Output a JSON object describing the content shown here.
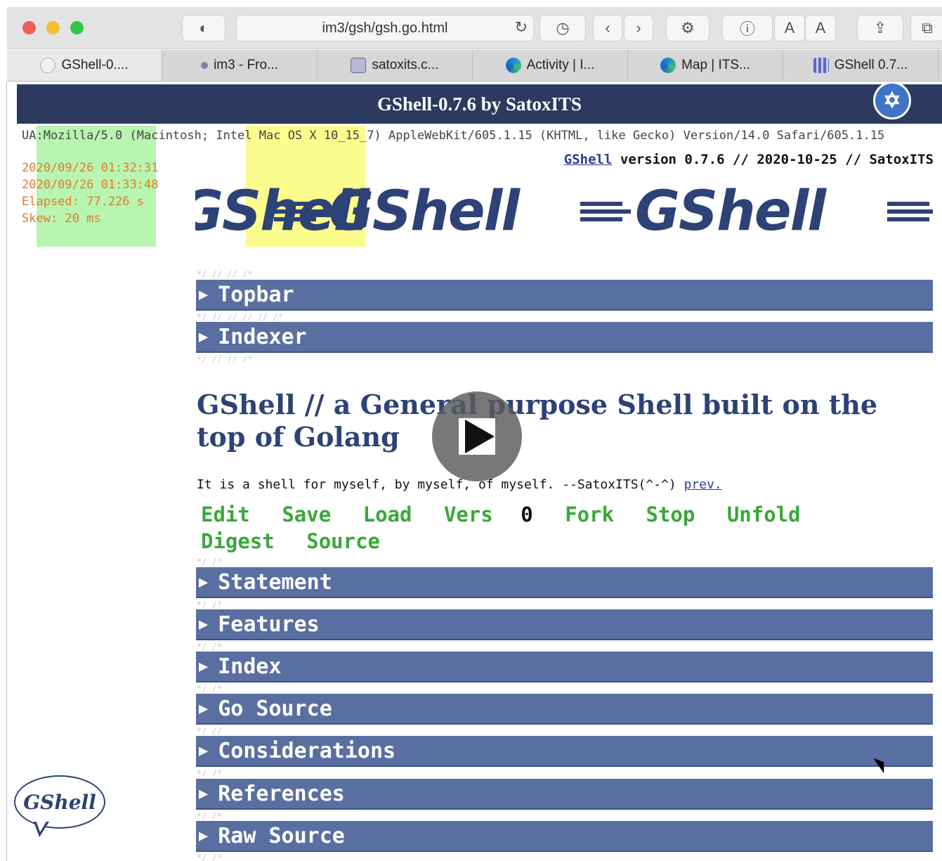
{
  "browser": {
    "address": "im3/gsh/gsh.go.html",
    "font_small": "A",
    "font_large": "A",
    "tabs": [
      {
        "label": "GShell-0....",
        "icon": "ghost-icon"
      },
      {
        "label": "im3 - Fro...",
        "icon": "dot-icon"
      },
      {
        "label": "satoxits.c...",
        "icon": "shield-icon"
      },
      {
        "label": "Activity | I...",
        "icon": "edge-icon"
      },
      {
        "label": "Map | ITS...",
        "icon": "edge-icon"
      },
      {
        "label": "GShell 0.7...",
        "icon": "qr-icon"
      }
    ]
  },
  "page": {
    "title": "GShell-0.7.6 by SatoxITS",
    "ua": "UA:Mozilla/5.0 (Macintosh; Intel Mac OS X 10_15_7) AppleWebKit/605.1.15 (KHTML, like Gecko) Version/14.0 Safari/605.1.15",
    "time_start": "2020/09/26 01:32:31",
    "time_now": "2020/09/26 01:33:48",
    "elapsed": "Elapsed: 77.226 s",
    "skew": "Skew: 20 ms",
    "version_link": "GShell",
    "version_text": " version 0.7.6 // 2020-10-25 // SatoxITS",
    "logo_text": "GShell",
    "notes": [
      "*/ // // /*",
      "*/ // // // // /*",
      "*/ // // /*",
      "*/ /*",
      "*/ /*",
      "*/ /*",
      "*/ /*",
      "*/ //",
      "//",
      "*/ /*",
      "*/ /*",
      "*/ /*"
    ],
    "sections_top": [
      "Topbar",
      "Indexer"
    ],
    "heading": "GShell // a General purpose Shell built on the top of Golang",
    "tagline": "It is a shell for myself, by myself, of myself. --SatoxITS(^-^) ",
    "tagline_link": "prev.",
    "menu": {
      "edit": "Edit",
      "save": "Save",
      "load": "Load",
      "vers": "Vers",
      "vers_num": "0",
      "fork": "Fork",
      "stop": "Stop",
      "unfold": "Unfold",
      "digest": "Digest",
      "source": "Source"
    },
    "sections": [
      "Statement",
      "Features",
      "Index",
      "Go Source",
      "Considerations",
      "References",
      "Raw Source"
    ],
    "bubble_text": "GShell",
    "triangle": "▶"
  },
  "colors": {
    "titlebar": "#2b3a5e",
    "section": "#5a6fa1",
    "heading": "#2d4276",
    "menu": "#3aa83a",
    "stat": "#e07a2e"
  }
}
